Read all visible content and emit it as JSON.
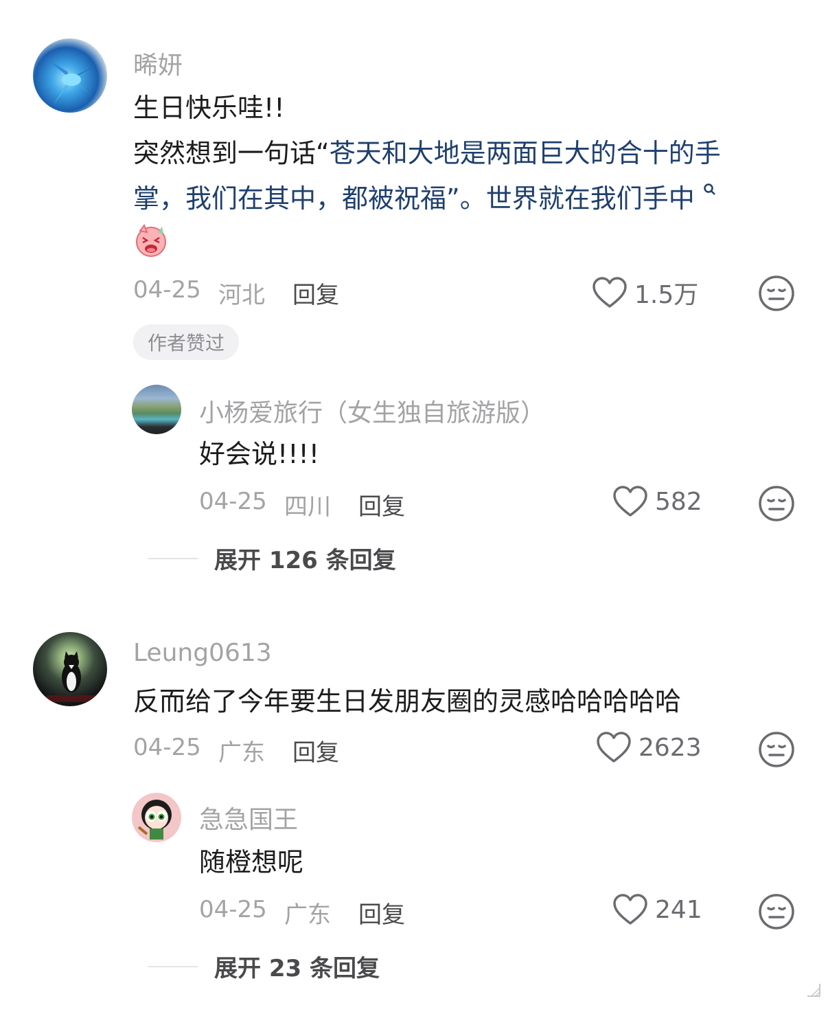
{
  "comments": [
    {
      "name": "晞妍",
      "text_line1": "生日快乐哇!!",
      "text_line2_plain": "突然想到一句话“",
      "text_line2_link": "苍天和大地是两面巨大的合十的手",
      "text_line3_link": "掌，我们在其中，都被祝福",
      "text_line3_tail": "”。世界就在我们手中",
      "emoji": "laughing-pig-emoji",
      "date": "04-25",
      "location": "河北",
      "reply_label": "回复",
      "likes": "1.5万",
      "badge": "作者赞过",
      "replies": [
        {
          "name": "小杨爱旅行（女生独自旅游版）",
          "text": "好会说!!!!",
          "date": "04-25",
          "location": "四川",
          "reply_label": "回复",
          "likes": "582"
        }
      ],
      "expand_label": "展开 126 条回复"
    },
    {
      "name": "Leung0613",
      "text": "反而给了今年要生日发朋友圈的灵感哈哈哈哈哈",
      "date": "04-25",
      "location": "广东",
      "reply_label": "回复",
      "likes": "2623",
      "replies": [
        {
          "name": "急急国王",
          "text": "随橙想呢",
          "date": "04-25",
          "location": "广东",
          "reply_label": "回复",
          "likes": "241"
        }
      ],
      "expand_label": "展开 23 条回复"
    }
  ]
}
